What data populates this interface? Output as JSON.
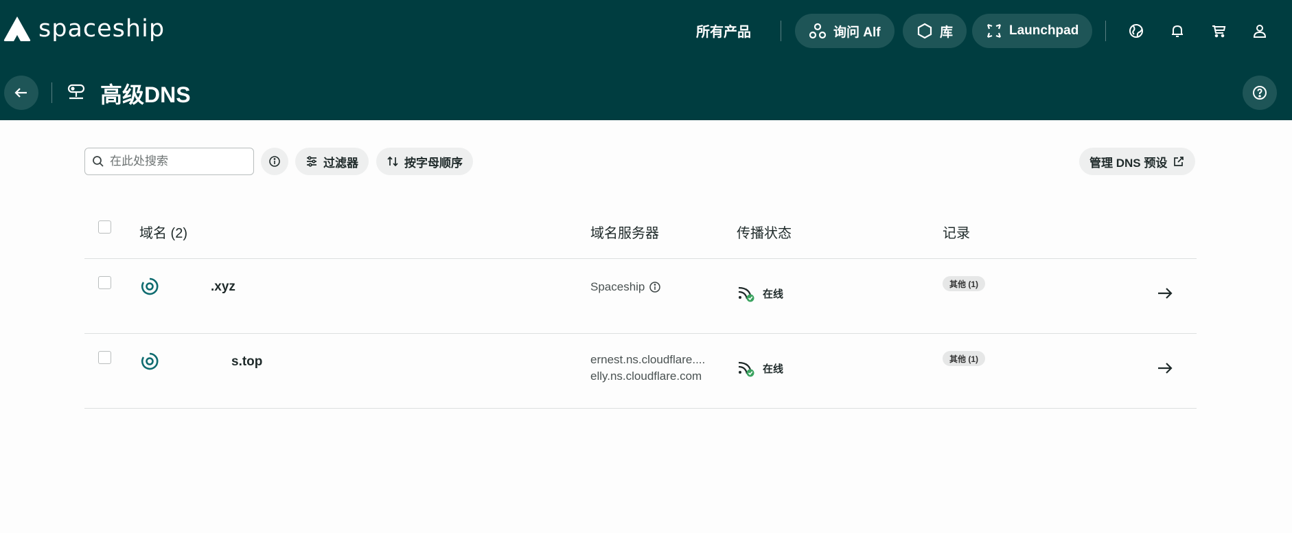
{
  "header": {
    "brand": "spaceship",
    "nav_all_products": "所有产品",
    "pills": [
      {
        "label": "询问 Alf"
      },
      {
        "label": "库"
      },
      {
        "label": "Launchpad"
      }
    ],
    "page_title": "高级DNS"
  },
  "toolbar": {
    "search_placeholder": "在此处搜索",
    "filter_label": "过滤器",
    "sort_label": "按字母顺序",
    "manage_presets_label": "管理 DNS 预设"
  },
  "table": {
    "columns": {
      "domain": "域名 (2)",
      "nameservers": "域名服务器",
      "propagation": "传播状态",
      "records": "记录"
    },
    "rows": [
      {
        "domain": ".xyz",
        "nameservers_line1": "Spaceship",
        "nameservers_line2": "",
        "status": "在线",
        "records_badge": "其他 (1)"
      },
      {
        "domain": "s.top",
        "nameservers_line1": "ernest.ns.cloudflare....",
        "nameservers_line2": "elly.ns.cloudflare.com",
        "status": "在线",
        "records_badge": "其他 (1)"
      }
    ]
  },
  "colors": {
    "header_bg": "#003d40",
    "pill_bg": "#1e5557",
    "domain_icon": "#0e6b6f",
    "status_ok": "#3aa35f"
  },
  "icons": {
    "logo": "spaceship-logo-icon",
    "alf": "alf-icon",
    "library": "hexagon-icon",
    "launchpad": "launchpad-icon",
    "globe": "globe-icon",
    "bell": "bell-icon",
    "cart": "cart-icon",
    "user": "user-icon",
    "back": "arrow-left-icon",
    "dns": "dns-icon",
    "help": "help-icon"
  }
}
